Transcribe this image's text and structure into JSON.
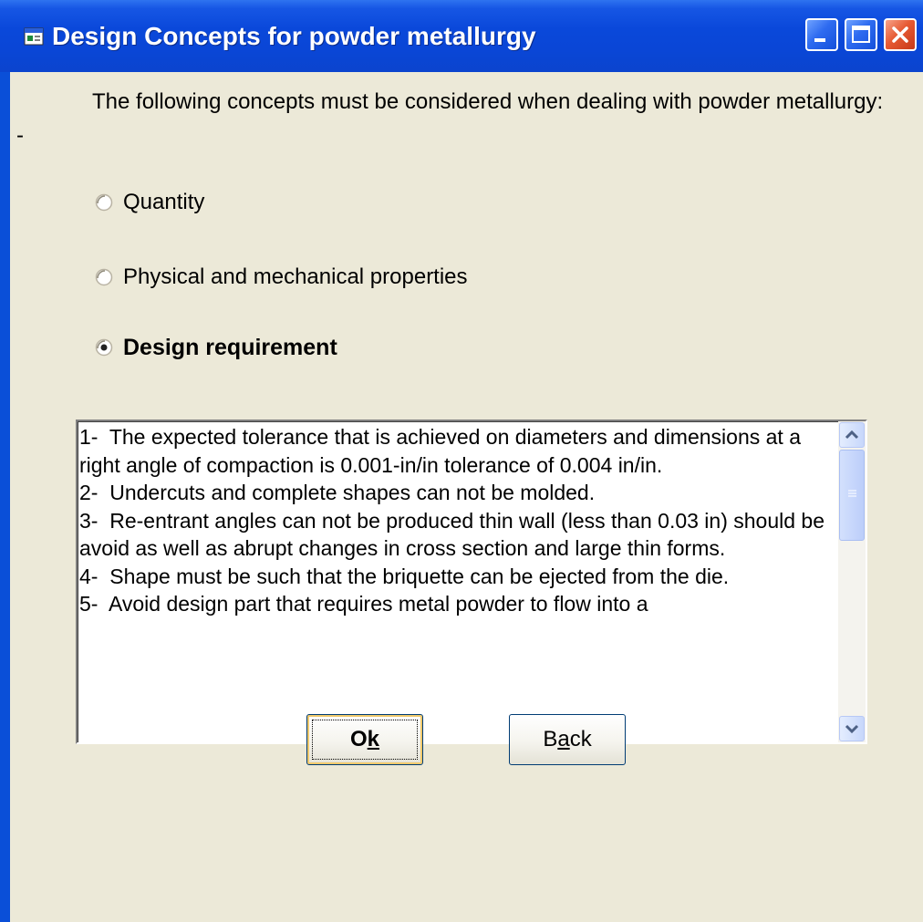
{
  "window": {
    "title": "Design Concepts for powder metallurgy"
  },
  "intro": {
    "text": "The following concepts must be considered when dealing with powder metallurgy: -"
  },
  "options": [
    {
      "label": "Quantity",
      "selected": false
    },
    {
      "label": "Physical and mechanical properties",
      "selected": false
    },
    {
      "label": "Design requirement",
      "selected": true
    }
  ],
  "details": {
    "text": "1-  The expected tolerance that is achieved on diameters and dimensions at a right angle of compaction is 0.001-in/in tolerance of 0.004 in/in.\n2-  Undercuts and complete shapes can not be molded.\n3-  Re-entrant angles can not be produced thin wall (less than 0.03 in) should be avoid as well as abrupt changes in cross section and large thin forms.\n4-  Shape must be such that the briquette can be ejected from the die.\n5-  Avoid design part that requires metal powder to flow into a"
  },
  "buttons": {
    "ok": {
      "pre": "O",
      "mnemonic": "k",
      "post": ""
    },
    "back": {
      "pre": "B",
      "mnemonic": "a",
      "post": "ck"
    }
  }
}
